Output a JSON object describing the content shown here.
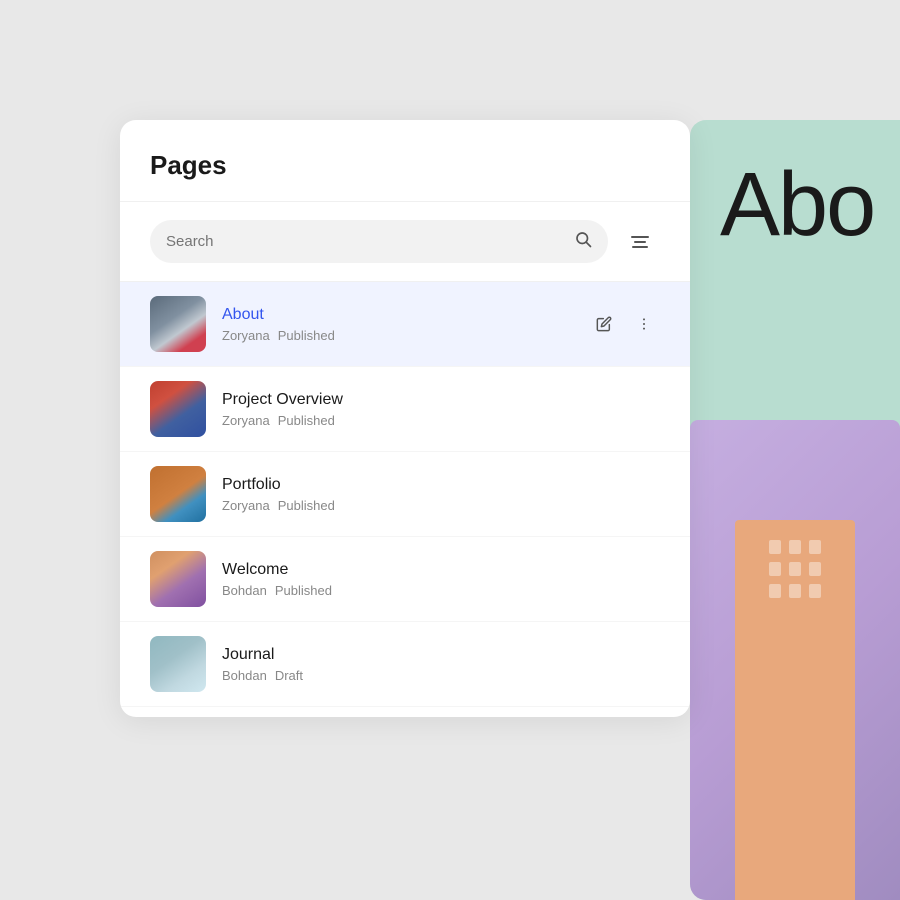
{
  "panel": {
    "title": "Pages"
  },
  "search": {
    "placeholder": "Search"
  },
  "pages": [
    {
      "id": "about",
      "name": "About",
      "author": "Zoryana",
      "status": "Published",
      "active": true,
      "thumb_class": "thumb-about"
    },
    {
      "id": "project-overview",
      "name": "Project Overview",
      "author": "Zoryana",
      "status": "Published",
      "active": false,
      "thumb_class": "thumb-project"
    },
    {
      "id": "portfolio",
      "name": "Portfolio",
      "author": "Zoryana",
      "status": "Published",
      "active": false,
      "thumb_class": "thumb-portfolio"
    },
    {
      "id": "welcome",
      "name": "Welcome",
      "author": "Bohdan",
      "status": "Published",
      "active": false,
      "thumb_class": "thumb-welcome"
    },
    {
      "id": "journal",
      "name": "Journal",
      "author": "Bohdan",
      "status": "Draft",
      "active": false,
      "thumb_class": "thumb-journal"
    }
  ],
  "icons": {
    "search": "🔍",
    "edit": "✏",
    "more": "⋮",
    "filter": "filter"
  },
  "bg": {
    "green_text": "Abo",
    "accent_blue": "#3355ee",
    "accent_green": "#b8ddd0",
    "accent_purple": "#c5aee0"
  }
}
